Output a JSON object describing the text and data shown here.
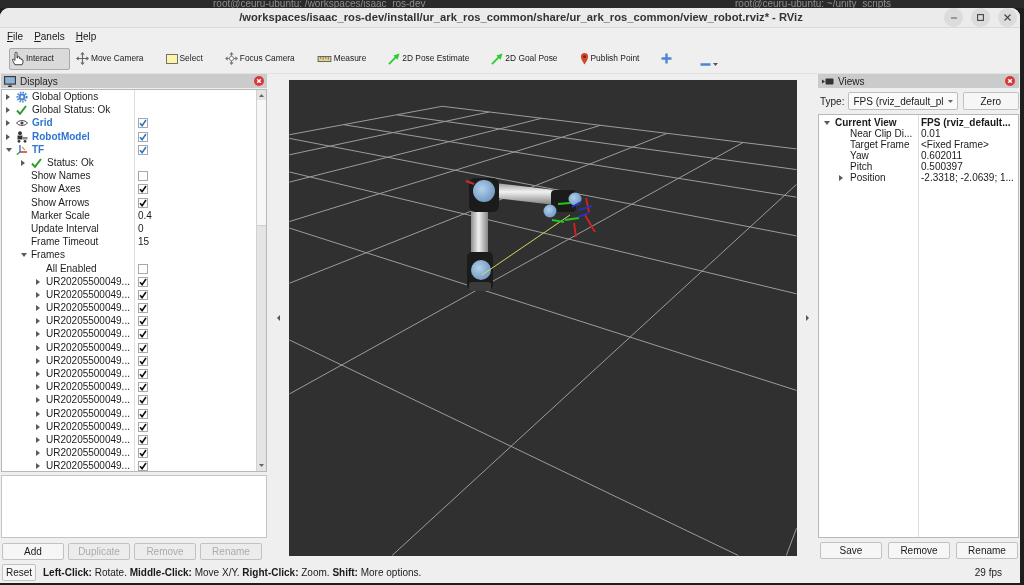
{
  "background_windows": [
    {
      "title": "root@ceuru-ubuntu: /workspaces/isaac_ros-dev"
    },
    {
      "title": "root@ceuru-ubuntu: ~/unity_scripts"
    }
  ],
  "window": {
    "title": "/workspaces/isaac_ros-dev/install/ur_ark_ros_common/share/ur_ark_ros_common/view_robot.rviz* - RViz"
  },
  "menu": [
    "File",
    "Panels",
    "Help"
  ],
  "toolbar": [
    {
      "kind": "interact",
      "label": "Interact",
      "selected": true
    },
    {
      "kind": "move_camera",
      "label": "Move Camera",
      "selected": false
    },
    {
      "kind": "select",
      "label": "Select",
      "selected": false
    },
    {
      "kind": "focus_camera",
      "label": "Focus Camera",
      "selected": false
    },
    {
      "kind": "measure",
      "label": "Measure",
      "selected": false
    },
    {
      "kind": "pose_estimate",
      "label": "2D Pose Estimate",
      "selected": false
    },
    {
      "kind": "goal_pose",
      "label": "2D Goal Pose",
      "selected": false
    },
    {
      "kind": "publish_point",
      "label": "Publish Point",
      "selected": false
    },
    {
      "kind": "add_tool"
    },
    {
      "kind": "remove_tool"
    }
  ],
  "displays": {
    "title": "Displays",
    "tree": [
      {
        "kind": "options",
        "label": "Global Options",
        "expanded": false
      },
      {
        "kind": "status",
        "label": "Global Status: Ok",
        "expanded": false
      },
      {
        "kind": "grid_display",
        "label": "Grid",
        "expanded": false,
        "checked": true
      },
      {
        "kind": "robot_model_display",
        "label": "RobotModel",
        "expanded": false,
        "checked": true
      },
      {
        "kind": "tf_display",
        "label": "TF",
        "expanded": true,
        "checked": true,
        "children": [
          {
            "kind": "status",
            "label": "Status: Ok",
            "expanded": false
          },
          {
            "kind": "property",
            "label": "Show Names",
            "checked": false
          },
          {
            "kind": "property",
            "label": "Show Axes",
            "checked": true
          },
          {
            "kind": "property",
            "label": "Show Arrows",
            "checked": true
          },
          {
            "kind": "property",
            "label": "Marker Scale",
            "value": "0.4"
          },
          {
            "kind": "property",
            "label": "Update Interval",
            "value": "0"
          },
          {
            "kind": "property",
            "label": "Frame Timeout",
            "value": "15"
          },
          {
            "kind": "property",
            "label": "Frames",
            "expanded": true,
            "children": [
              {
                "kind": "property",
                "label": "All Enabled",
                "checked": false
              },
              {
                "kind": "property",
                "label": "UR20205500049...",
                "expanded": false,
                "checked": true
              },
              {
                "kind": "property",
                "label": "UR20205500049...",
                "expanded": false,
                "checked": true
              },
              {
                "kind": "property",
                "label": "UR20205500049...",
                "expanded": false,
                "checked": true
              },
              {
                "kind": "property",
                "label": "UR20205500049...",
                "expanded": false,
                "checked": true
              },
              {
                "kind": "property",
                "label": "UR20205500049...",
                "expanded": false,
                "checked": true
              },
              {
                "kind": "property",
                "label": "UR20205500049...",
                "expanded": false,
                "checked": true
              },
              {
                "kind": "property",
                "label": "UR20205500049...",
                "expanded": false,
                "checked": true
              },
              {
                "kind": "property",
                "label": "UR20205500049...",
                "expanded": false,
                "checked": true
              },
              {
                "kind": "property",
                "label": "UR20205500049...",
                "expanded": false,
                "checked": true
              },
              {
                "kind": "property",
                "label": "UR20205500049...",
                "expanded": false,
                "checked": true
              },
              {
                "kind": "property",
                "label": "UR20205500049...",
                "expanded": false,
                "checked": true
              },
              {
                "kind": "property",
                "label": "UR20205500049...",
                "expanded": false,
                "checked": true
              },
              {
                "kind": "property",
                "label": "UR20205500049...",
                "expanded": false,
                "checked": true
              },
              {
                "kind": "property",
                "label": "UR20205500049...",
                "expanded": false,
                "checked": true
              },
              {
                "kind": "property",
                "label": "UR20205500049...",
                "expanded": false,
                "checked": true
              }
            ]
          }
        ]
      }
    ],
    "buttons": [
      {
        "label": "Add",
        "disabled": false
      },
      {
        "label": "Duplicate",
        "disabled": true
      },
      {
        "label": "Remove",
        "disabled": true
      },
      {
        "label": "Rename",
        "disabled": true
      }
    ]
  },
  "views": {
    "title": "Views",
    "type_label": "Type:",
    "type_value": "FPS (rviz_default_pl",
    "zero_button": "Zero",
    "tree": [
      {
        "label": "Current View",
        "value": "FPS (rviz_default...",
        "expanded": true,
        "children": [
          {
            "label": "Near Clip Di...",
            "value": "0.01"
          },
          {
            "label": "Target Frame",
            "value": "<Fixed Frame>"
          },
          {
            "label": "Yaw",
            "value": "0.602011"
          },
          {
            "label": "Pitch",
            "value": "0.500397"
          },
          {
            "label": "Position",
            "value": "-2.3318; -2.0639; 1...",
            "expanded": false
          }
        ]
      }
    ],
    "buttons": [
      {
        "label": "Save",
        "disabled": false
      },
      {
        "label": "Remove",
        "disabled": false
      },
      {
        "label": "Rename",
        "disabled": false
      }
    ]
  },
  "status_bar": {
    "reset_button": "Reset",
    "hint": "**Left-Click:** Rotate. **Middle-Click:** Move X/Y. **Right-Click:** Zoom. **Shift:** More options.",
    "fps": "29 fps"
  }
}
